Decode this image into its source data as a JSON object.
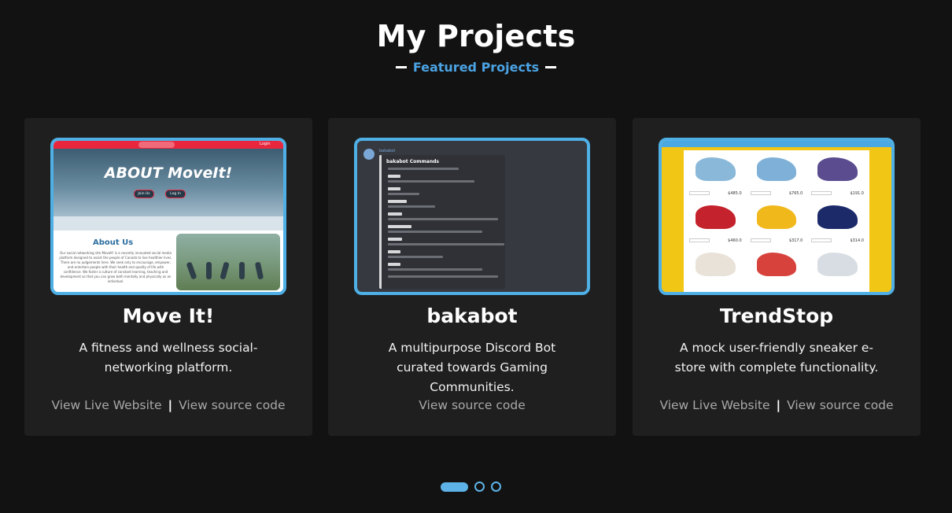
{
  "header": {
    "title": "My Projects",
    "subtitle": "Featured Projects"
  },
  "projects": [
    {
      "title": "Move It!",
      "description": "A fitness and wellness social-networking platform.",
      "link_live": "View Live Website",
      "separator": "|",
      "link_source": "View source code",
      "thumb": {
        "hero_text": "ABOUT MoveIt!",
        "btn1": "Join Us",
        "btn2": "Log In",
        "nav_login": "Login",
        "about_heading": "About Us",
        "about_text": "Our social networking site MoveIt! is a recently innovated social media platform designed to assist the people of Canada to live healthier lives. There are no judgements here. We seek only to encourage, empower, and entertain people with their health and quality of life with confidence. We foster a culture of constant learning, teaching and development so that you can grow both mentally and physically as an individual."
      }
    },
    {
      "title": "bakabot",
      "description": "A multipurpose Discord Bot curated towards Gaming Communities.",
      "link_source": "View source code",
      "thumb": {
        "bot_name": "bakabot",
        "embed_title": "bakabot Commands"
      }
    },
    {
      "title": "TrendStop",
      "description": "A mock user-friendly sneaker e-store with complete functionality.",
      "link_live": "View Live Website",
      "separator": "|",
      "link_source": "View source code",
      "thumb": {
        "prices": [
          "$485.0",
          "$765.0",
          "$191.0",
          "$460.0",
          "$317.0",
          "$314.0",
          "",
          "",
          ""
        ]
      }
    }
  ],
  "carousel": {
    "slides": 3,
    "active_index": 0
  },
  "colors": {
    "accent": "#4fb0e6",
    "background": "#121212",
    "card": "#1f1f1f"
  }
}
